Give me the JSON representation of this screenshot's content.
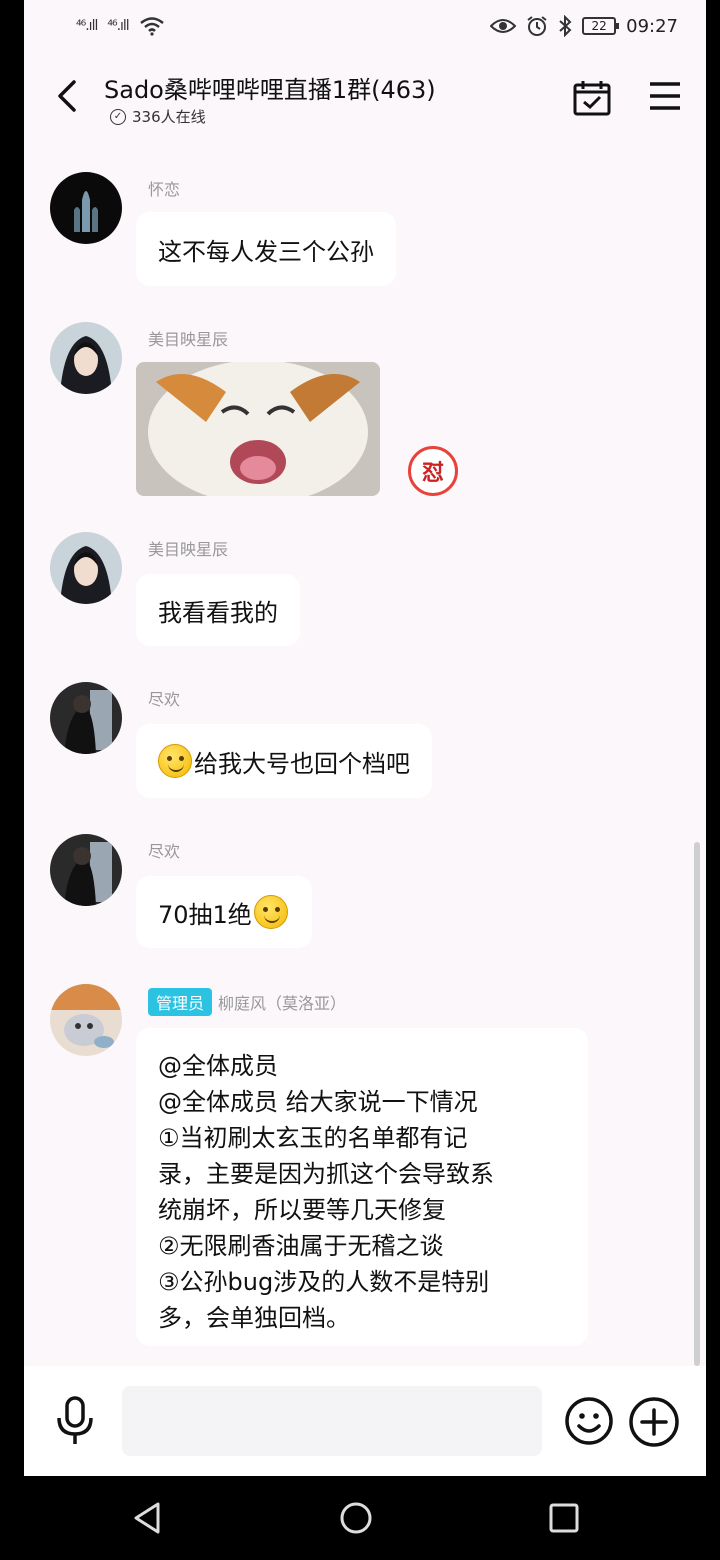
{
  "status_bar": {
    "signal_1": "⁴⁶.ıll",
    "signal_2": "⁴⁶.ıll",
    "battery": "22",
    "time": "09:27"
  },
  "header": {
    "title": "Sado桑哔哩哔哩直播1群(463)",
    "online": "336人在线"
  },
  "messages": [
    {
      "sender": "怀恋",
      "text": "这不每人发三个公孙"
    },
    {
      "sender": "美目映星辰",
      "image": "cat-laughing",
      "badge": "怼"
    },
    {
      "sender": "美目映星辰",
      "text": "我看看我的"
    },
    {
      "sender": "尽欢",
      "text": "给我大号也回个档吧"
    },
    {
      "sender": "尽欢",
      "text": "70抽1绝"
    },
    {
      "sender": "柳庭风（莫洛亚）",
      "role": "管理员",
      "lines": [
        "@全体成员",
        "@全体成员 给大家说一下情况",
        "①当初刷太玄玉的名单都有记",
        "录，主要是因为抓这个会导致系",
        "统崩坏，所以要等几天修复",
        "②无限刷香油属于无稽之谈",
        "③公孙bug涉及的人数不是特别",
        "多，会单独回档。"
      ]
    }
  ],
  "colors": {
    "background": "#fbf7fb",
    "bubble": "#ffffff",
    "admin_tag": "#2cc3e3",
    "name": "#999999"
  },
  "icons": {
    "back": "back-arrow-icon",
    "calendar": "calendar-check-icon",
    "menu": "menu-icon",
    "mic": "microphone-icon",
    "smile": "smile-face-icon",
    "plus": "plus-circle-icon"
  }
}
